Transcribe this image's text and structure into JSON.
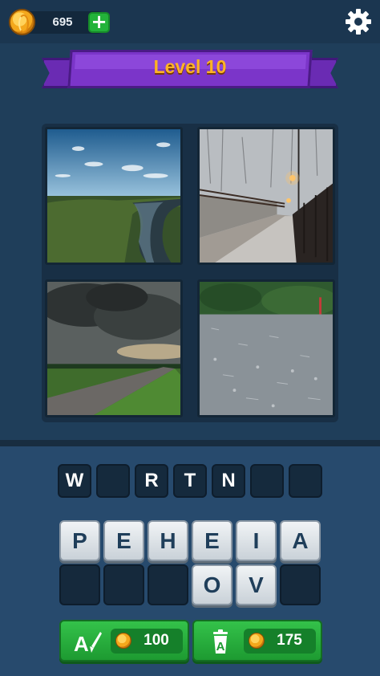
{
  "header": {
    "coins": "695",
    "add_coins_icon": "plus-icon",
    "settings_icon": "gear-icon"
  },
  "banner": {
    "title": "Level 10"
  },
  "pictures": [
    {
      "name": "river-valley-aerial",
      "position": "top-left"
    },
    {
      "name": "snowy-bridge-walkway",
      "position": "top-right"
    },
    {
      "name": "storm-clouds-over-road",
      "position": "bottom-left"
    },
    {
      "name": "rain-on-pavement",
      "position": "bottom-right"
    }
  ],
  "answer_slots": [
    "W",
    "",
    "R",
    "T",
    "N",
    "",
    ""
  ],
  "letter_keys_row1": [
    "P",
    "E",
    "H",
    "E",
    "I",
    "A"
  ],
  "letter_keys_row2": [
    "",
    "",
    "",
    "O",
    "V",
    ""
  ],
  "hints": [
    {
      "icon": "reveal-letter-icon",
      "price": "100"
    },
    {
      "icon": "remove-letters-icon",
      "price": "175"
    }
  ],
  "colors": {
    "background": "#1f3e5a",
    "banner": "#7b35c9",
    "level_text": "#ffb326",
    "hint_button": "#2bb040"
  }
}
